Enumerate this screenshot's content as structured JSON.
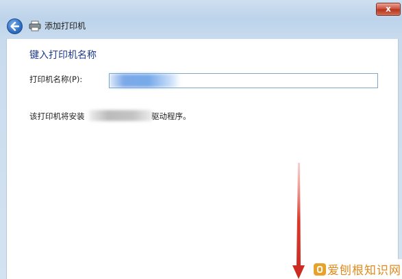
{
  "window": {
    "title": "添加打印机",
    "close_label": "x"
  },
  "page": {
    "heading": "键入打印机名称",
    "printer_name_label": "打印机名称(P):",
    "printer_name_value": "",
    "driver_prefix": "该打印机将安装",
    "driver_suffix": "驱动程序。"
  },
  "watermark": {
    "text": "爱刨根知识网"
  },
  "colors": {
    "accent_arrow": "#d9372c",
    "heading": "#1e3a8a",
    "close_button": "#c94a35"
  }
}
